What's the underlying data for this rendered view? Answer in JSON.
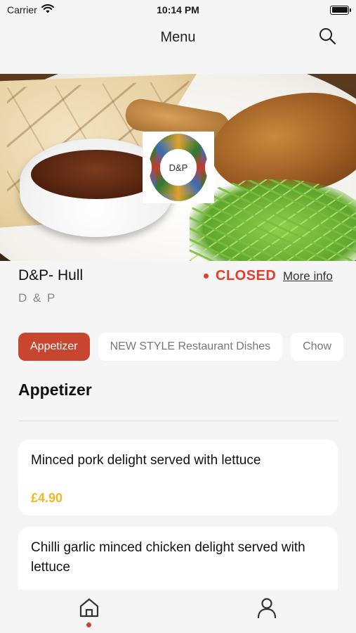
{
  "status_bar": {
    "carrier": "Carrier",
    "time": "10:14 PM",
    "wifi_icon": "wifi-icon",
    "battery_icon": "battery-icon"
  },
  "header": {
    "title": "Menu",
    "search_icon": "search-icon"
  },
  "hero": {
    "logo_text": "D&P"
  },
  "restaurant": {
    "name": "D&P- Hull",
    "subtitle": "D & P",
    "status": "CLOSED",
    "status_color": "#e23c2c",
    "more_info": "More info"
  },
  "categories": [
    {
      "label": "Appetizer",
      "active": true
    },
    {
      "label": "NEW STYLE Restaurant Dishes",
      "active": false
    },
    {
      "label": "Chow",
      "active": false
    }
  ],
  "section": {
    "title": "Appetizer"
  },
  "items": [
    {
      "title": "Minced pork delight served with lettuce",
      "price": "£4.90"
    },
    {
      "title": "Chilli garlic minced chicken delight served with  lettuce",
      "price": ""
    }
  ],
  "tabbar": {
    "items": [
      {
        "icon": "home-icon",
        "active": true
      },
      {
        "icon": "profile-icon",
        "active": false
      }
    ]
  },
  "colors": {
    "accent": "#c8452f",
    "price": "#f0b928",
    "closed": "#e23c2c"
  }
}
